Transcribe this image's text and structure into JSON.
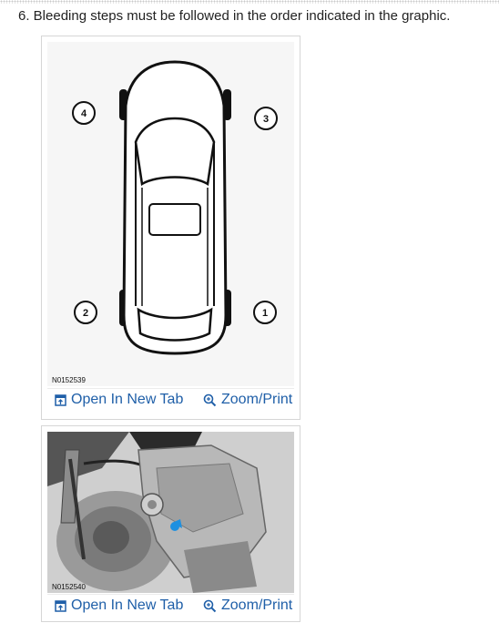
{
  "instruction": {
    "text": "6. Bleeding steps must be followed in the order indicated in the graphic."
  },
  "figures": [
    {
      "code": "N0152539",
      "markers": [
        "1",
        "2",
        "3",
        "4"
      ],
      "open_label": "Open In New Tab",
      "zoom_label": "Zoom/Print",
      "open_icon": "open-new-tab-icon",
      "zoom_icon": "magnifier-icon"
    },
    {
      "code": "N0152540",
      "open_label": "Open In New Tab",
      "zoom_label": "Zoom/Print",
      "open_icon": "open-new-tab-icon",
      "zoom_icon": "magnifier-icon"
    }
  ],
  "colors": {
    "link": "#1f5fa8",
    "bleeder_marker": "#1e90e0"
  }
}
